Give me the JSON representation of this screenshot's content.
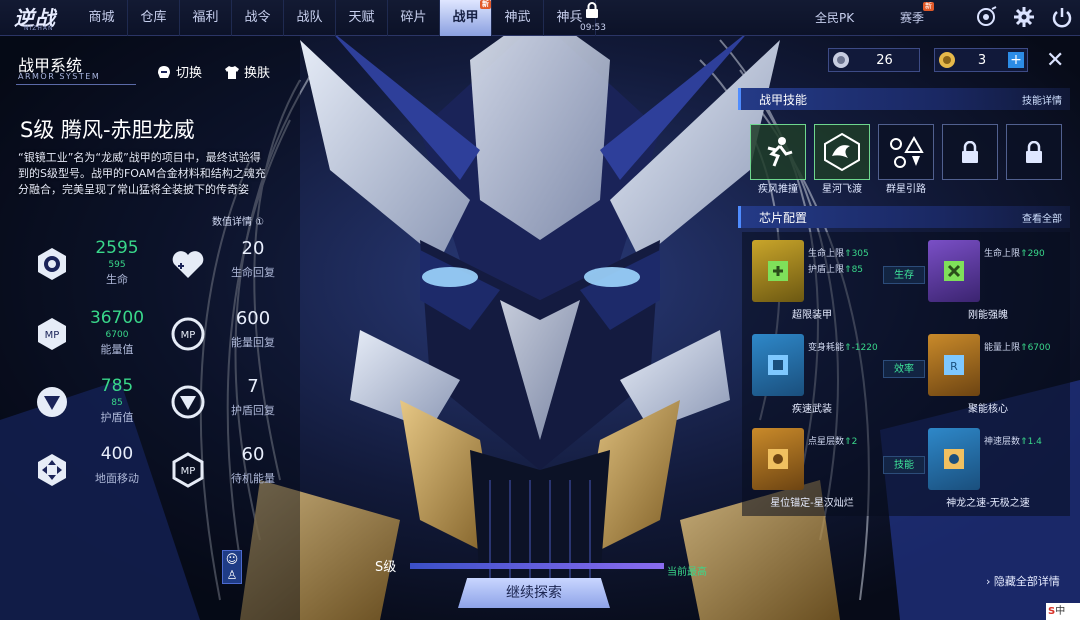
{
  "app": {
    "logo": "逆战",
    "logo_sub": "NIZHAN"
  },
  "nav": {
    "items": [
      {
        "label": "商城",
        "active": false,
        "new": false
      },
      {
        "label": "仓库",
        "active": false,
        "new": false
      },
      {
        "label": "福利",
        "active": false,
        "new": false
      },
      {
        "label": "战令",
        "active": false,
        "new": false
      },
      {
        "label": "战队",
        "active": false,
        "new": false
      },
      {
        "label": "天赋",
        "active": false,
        "new": false
      },
      {
        "label": "碎片",
        "active": false,
        "new": false
      },
      {
        "label": "战甲",
        "active": true,
        "new": true
      },
      {
        "label": "神武",
        "active": false,
        "new": false
      },
      {
        "label": "神兵",
        "active": false,
        "new": false
      }
    ],
    "new_badge": "新",
    "time": "09:53",
    "pk": "全民PK",
    "season": "赛季"
  },
  "left": {
    "system_title": "战甲系统",
    "system_sub": "ARMOR SYSTEM",
    "switch": "切换",
    "skin": "换肤",
    "mech_name": "S级 腾风-赤胆龙威",
    "description": "“银镜工业”名为“龙威”战甲的项目中，最终试验得到的S级型号。战甲的FOAM合金材料和结构之魂充分融合，完美呈现了常山猛将全装披下的传奇姿",
    "detail_link": "数值详情 ①",
    "stats": [
      {
        "value": "2595",
        "sub": "595",
        "label": "生命"
      },
      {
        "value": "36700",
        "sub": "6700",
        "label": "能量值"
      },
      {
        "value": "785",
        "sub": "85",
        "label": "护盾值"
      },
      {
        "value": "400",
        "sub": "",
        "label": "地面移动"
      }
    ],
    "stats_right": [
      {
        "value": "20",
        "label": "生命回复"
      },
      {
        "value": "600",
        "label": "能量回复"
      },
      {
        "value": "7",
        "label": "护盾回复"
      },
      {
        "value": "60",
        "label": "待机能量"
      }
    ]
  },
  "right": {
    "currency": [
      {
        "value": "26"
      },
      {
        "value": "3"
      }
    ],
    "skills_title": "战甲技能",
    "skills_link": "技能详情",
    "skills": [
      {
        "label": "疾风推撞",
        "state": "on"
      },
      {
        "label": "星河飞渡",
        "state": "on"
      },
      {
        "label": "群星引路",
        "state": "off"
      },
      {
        "label": "",
        "state": "locked"
      },
      {
        "label": "",
        "state": "locked"
      }
    ],
    "chips_title": "芯片配置",
    "chips_link": "查看全部",
    "categories": [
      "生存",
      "效率",
      "技能"
    ],
    "chips": [
      {
        "name": "超限装甲",
        "attr1": "生命上限",
        "val1": "305",
        "attr2": "护盾上限",
        "val2": "85",
        "color": "g"
      },
      {
        "name": "刚能强魄",
        "attr1": "生命上限",
        "val1": "290",
        "attr2": "",
        "val2": "",
        "color": "p"
      },
      {
        "name": "疾速武装",
        "attr1": "变身耗能",
        "val1": "-1220",
        "attr2": "",
        "val2": "",
        "color": "b"
      },
      {
        "name": "聚能核心",
        "attr1": "能量上限",
        "val1": "6700",
        "attr2": "",
        "val2": "",
        "color": "o"
      },
      {
        "name": "星位锚定-星汉灿烂",
        "attr1": "点星层数",
        "val1": "2",
        "attr2": "",
        "val2": "",
        "color": "o"
      },
      {
        "name": "神龙之速-无极之速",
        "attr1": "神速层数",
        "val1": "1.4",
        "attr2": "",
        "val2": "",
        "color": "b"
      }
    ]
  },
  "bottom": {
    "rank": "S级",
    "current_max": "当前最高",
    "explore": "继续探索",
    "hide_all": "隐藏全部详情",
    "tray": "中"
  }
}
